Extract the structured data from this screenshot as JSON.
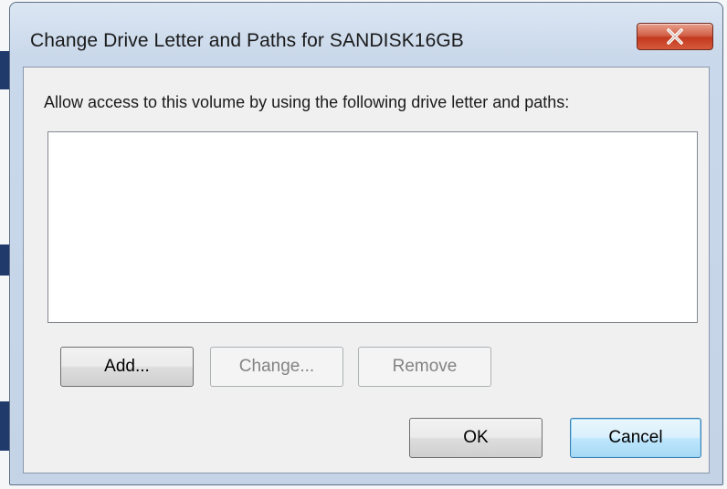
{
  "dialog": {
    "title": "Change Drive Letter and Paths for SANDISK16GB",
    "close_glyph": "x",
    "instruction": "Allow access to this volume by using the following drive letter and paths:",
    "paths_list": {
      "items": []
    },
    "buttons": {
      "add": "Add...",
      "change": "Change...",
      "remove": "Remove",
      "ok": "OK",
      "cancel": "Cancel"
    },
    "states": {
      "change_enabled": false,
      "remove_enabled": false,
      "default_button": "cancel"
    }
  },
  "icons": {
    "close": "close-icon"
  },
  "colors": {
    "frame": "#c9d8ea",
    "close_button": "#c7432a",
    "client_area": "#f0f0f0",
    "default_button_border": "#3c7fb1",
    "disabled_text": "#838383"
  }
}
